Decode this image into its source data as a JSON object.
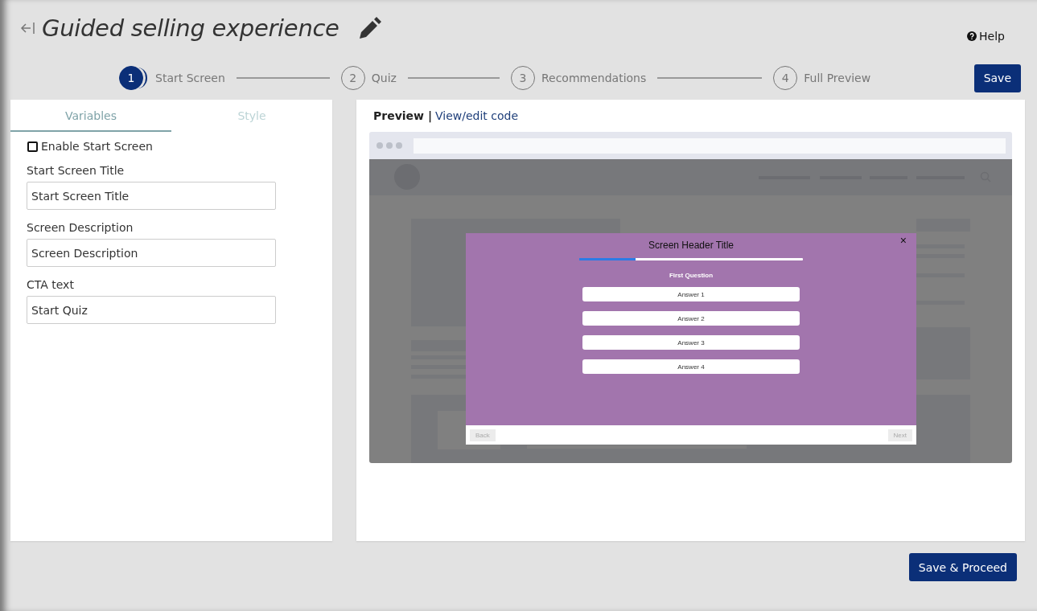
{
  "page": {
    "title": "Guided selling experience",
    "help": "Help"
  },
  "steps": [
    {
      "number": "1",
      "label": "Start Screen",
      "selected": true
    },
    {
      "number": "2",
      "label": "Quiz",
      "selected": false
    },
    {
      "number": "3",
      "label": "Recommendations",
      "selected": false
    },
    {
      "number": "4",
      "label": "Full Preview",
      "selected": false
    }
  ],
  "save_button": "Save",
  "panel_tabs": [
    {
      "label": "Variables",
      "selected": true
    },
    {
      "label": "Style",
      "selected": false
    }
  ],
  "enable_start_screen": {
    "label": "Enable Start Screen",
    "checked": false
  },
  "fields": [
    {
      "label": "Start Screen Title",
      "value": "Start Screen Title"
    },
    {
      "label": "Screen Description",
      "value": "Screen Description"
    },
    {
      "label": "CTA text",
      "value": "Start Quiz"
    }
  ],
  "preview": {
    "title": "Preview |",
    "code_link": "View/edit code"
  },
  "quiz_modal": {
    "title": "Screen Header Title",
    "close": "×",
    "progress": {
      "level": 0.25
    },
    "question": "First Question",
    "answers": [
      "Answer 1",
      "Answer 2",
      "Answer 3",
      "Answer 4"
    ],
    "back": "Back",
    "next": "Next"
  },
  "proceed_button": "Save & Proceed"
}
